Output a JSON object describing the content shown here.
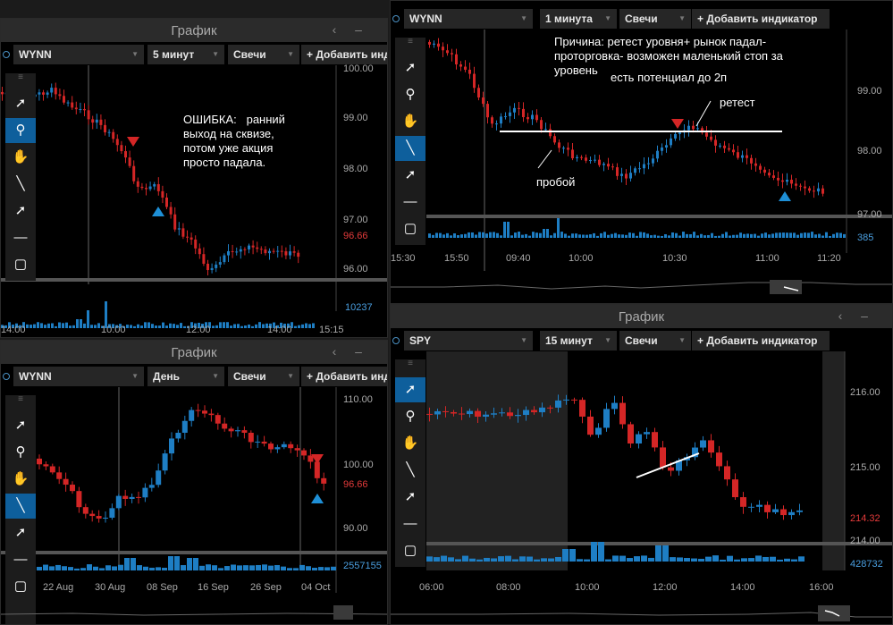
{
  "panels": {
    "top_left": {
      "window_title": "График",
      "symbol": "WYNN",
      "interval": "5 минут",
      "chart_type": "Свечи",
      "add_indicator": "+ Добавить индикатор",
      "prices": [
        "100.00",
        "99.00",
        "98.00",
        "97.00",
        "96.66",
        "96.00"
      ],
      "current_price": "96.66",
      "volume": "10237",
      "times": [
        "14:00",
        "10:00",
        "12:00",
        "14:00",
        "15:15"
      ],
      "annotation": "ОШИБКА:   ранний\nвыход на сквизе,\nпотом уже акция\nпросто падала."
    },
    "top_right": {
      "symbol": "WYNN",
      "interval": "1 минута",
      "chart_type": "Свечи",
      "add_indicator": "+ Добавить индикатор",
      "prices": [
        "99.00",
        "98.00",
        "97.00"
      ],
      "volume": "385",
      "times": [
        "15:30",
        "15:50",
        "09:40",
        "10:00",
        "10:30",
        "11:00",
        "11:20"
      ],
      "annotation_main": "Причина: ретест уровня+ рынок падал-\nпроторговка- возможен маленький стоп за\nуровень",
      "annotation_potential": "есть потенциал до 2п",
      "label_retest": "ретест",
      "label_breakout": "пробой"
    },
    "bottom_left": {
      "window_title": "График",
      "symbol": "WYNN",
      "interval": "День",
      "chart_type": "Свечи",
      "add_indicator": "+ Добавить индикатор",
      "prices": [
        "110.00",
        "100.00",
        "96.66",
        "90.00"
      ],
      "current_price": "96.66",
      "volume": "2557155",
      "dates": [
        "22 Aug",
        "30 Aug",
        "08 Sep",
        "16 Sep",
        "26 Sep",
        "04 Oct"
      ]
    },
    "bottom_right": {
      "window_title": "График",
      "symbol": "SPY",
      "interval": "15 минут",
      "chart_type": "Свечи",
      "add_indicator": "+ Добавить индикатор",
      "prices": [
        "216.00",
        "215.00",
        "214.32",
        "214.00"
      ],
      "current_price": "214.32",
      "volume": "428732",
      "times": [
        "06:00",
        "08:00",
        "10:00",
        "12:00",
        "14:00",
        "16:00"
      ]
    }
  },
  "colors": {
    "up": "#1e7ec4",
    "down": "#d42626",
    "accent": "#0e5f9c",
    "marker_down": "#d42626",
    "marker_up": "#1e8fd6"
  },
  "tools": [
    "tools-grip-icon",
    "cursor-icon",
    "zoom-icon",
    "hand-icon",
    "line-icon",
    "arrow-icon",
    "hline-icon",
    "rect-icon"
  ]
}
